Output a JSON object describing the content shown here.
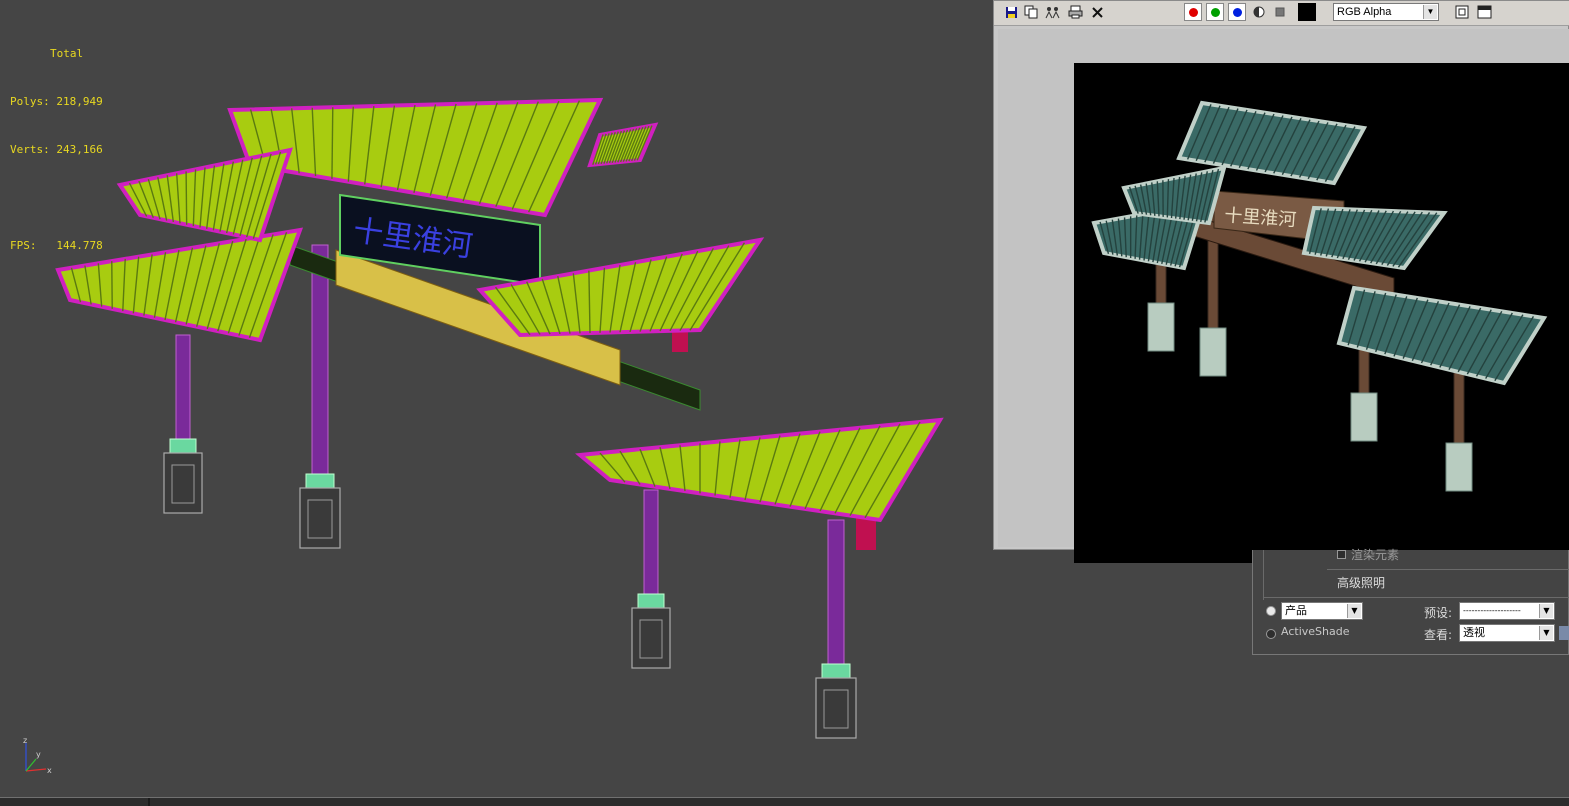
{
  "viewport": {
    "stats": {
      "header": "Total",
      "polys": "Polys: 218,949",
      "verts": "Verts: 243,166",
      "fps": "FPS:   144.778"
    },
    "sign_text": "十里淮河",
    "axis_labels": {
      "x": "x",
      "y": "y",
      "z": "z"
    }
  },
  "render_window": {
    "channel": "RGB Alpha",
    "channel_colors": {
      "red": "#e00000",
      "green": "#00a000",
      "blue": "#0020e0"
    },
    "icons": [
      "save-icon",
      "copy-icon",
      "clone-icon",
      "print-icon",
      "clear-icon",
      "mono-icon",
      "color-swatch-icon",
      "toggle-ui-icon",
      "display-icon"
    ],
    "sign_text": "十里淮河"
  },
  "render_setup": {
    "partial_item": "渲染元素",
    "advanced_lighting": "高级照明",
    "production": "产品",
    "activeshade": "ActiveShade",
    "preset_label": "预设:",
    "preset_value": "--------------------",
    "view_label": "查看:",
    "view_value": "透视"
  }
}
